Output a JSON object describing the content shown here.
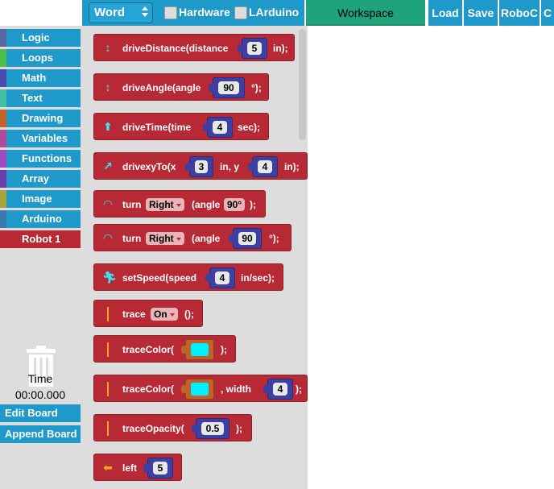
{
  "topbar": {
    "language": "Word",
    "hardware_label": "Hardware",
    "larduino_label": "LArduino",
    "workspace_label": "Workspace",
    "load_label": "Load",
    "save_label": "Save",
    "roboc_label": "RoboC",
    "cut_off_label": "C"
  },
  "categories": [
    {
      "label": "Logic",
      "color": "#5b67a5"
    },
    {
      "label": "Loops",
      "color": "#5ba55b"
    },
    {
      "label": "Math",
      "color": "#5b67a5"
    },
    {
      "label": "Text",
      "color": "#5ba58c"
    },
    {
      "label": "Drawing",
      "color": "#a5745b"
    },
    {
      "label": "Variables",
      "color": "#a55b80"
    },
    {
      "label": "Functions",
      "color": "#995ba5"
    },
    {
      "label": "Array",
      "color": "#745ba5"
    },
    {
      "label": "Image",
      "color": "#a5a55b"
    },
    {
      "label": "Arduino",
      "color": "#5b80a5"
    },
    {
      "label": "Robot 1",
      "color": "#b72a35"
    }
  ],
  "timer": {
    "label": "Time",
    "value": "00:00.000"
  },
  "side_buttons": {
    "edit_board": "Edit Board",
    "append_board": "Append Board"
  },
  "blocks": {
    "drive_distance": {
      "label": "driveDistance(distance",
      "value": "5",
      "suffix": "in);"
    },
    "drive_angle": {
      "label": "driveAngle(angle",
      "value": "90",
      "suffix": "°);"
    },
    "drive_time": {
      "label": "driveTime(time",
      "value": "4",
      "suffix": "sec);"
    },
    "drive_xy": {
      "label": "drivexyTo(x",
      "x": "3",
      "mid": "in, y",
      "y": "4",
      "suffix": "in);"
    },
    "turn_1": {
      "label": "turn",
      "dir": "Right",
      "mid": "(angle",
      "value": "90°",
      "suffix": ");"
    },
    "turn_2": {
      "label": "turn",
      "dir": "Right",
      "mid": "(angle",
      "value": "90",
      "suffix": "°);"
    },
    "set_speed": {
      "label": "setSpeed(speed",
      "value": "4",
      "suffix": "in/sec);"
    },
    "trace": {
      "label": "trace",
      "value": "On",
      "suffix": "();"
    },
    "trace_color": {
      "label": "traceColor(",
      "suffix": ");",
      "color": "#00f0ff"
    },
    "trace_color_width": {
      "label": "traceColor(",
      "mid": ", width",
      "value": "4",
      "suffix": ");",
      "color": "#00f0ff"
    },
    "trace_opacity": {
      "label": "traceOpacity(",
      "value": "0.5",
      "suffix": ");"
    },
    "left": {
      "label": "left",
      "value": "5"
    }
  }
}
